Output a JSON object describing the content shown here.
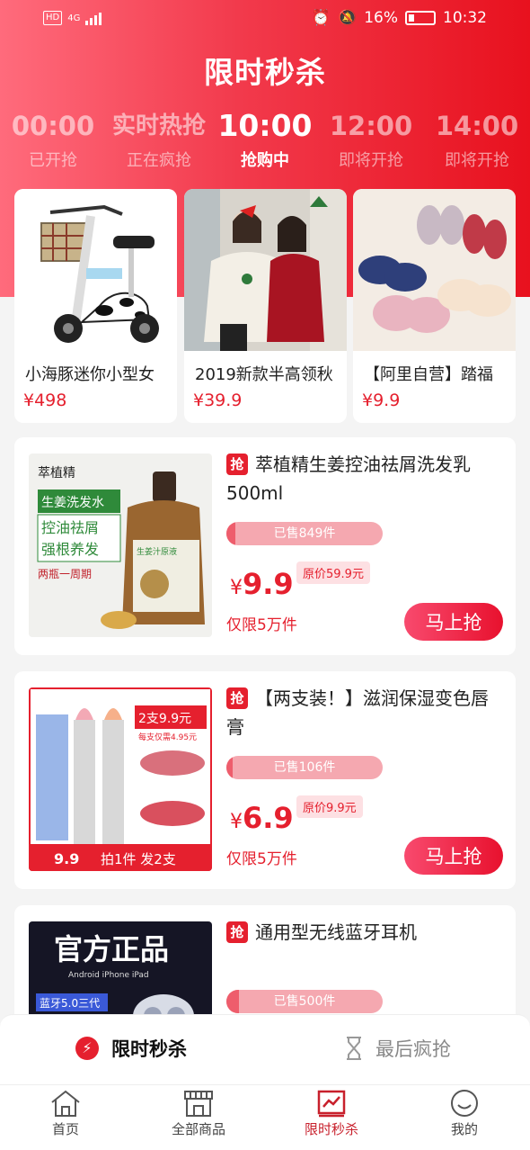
{
  "status_bar": {
    "network": "HD",
    "signal": "4G",
    "battery": "16%",
    "time": "10:32"
  },
  "header": {
    "title": "限时秒杀"
  },
  "sessions": [
    {
      "time": "00:00",
      "status": "已开抢"
    },
    {
      "time": "实时热抢",
      "status": "正在疯抢"
    },
    {
      "time": "10:00",
      "status": "抢购中"
    },
    {
      "time": "12:00",
      "status": "即将开抢"
    },
    {
      "time": "14:00",
      "status": "即将开抢"
    }
  ],
  "featured": [
    {
      "name": "小海豚迷你小型女",
      "price": "¥498"
    },
    {
      "name": "2019新款半高领秋",
      "price": "¥39.9"
    },
    {
      "name": "【阿里自营】踏福",
      "price": "¥9.9"
    }
  ],
  "items": [
    {
      "badge": "抢",
      "title": "萃植精生姜控油祛屑洗发乳500ml",
      "sold": "已售849件",
      "sold_ratio": 0.06,
      "yen": "¥",
      "price": "9.9",
      "original": "原价59.9元",
      "limit": "仅限5万件",
      "buy": "马上抢",
      "image_text": {
        "brand": "萃植精",
        "l1": "生姜洗发水",
        "l2": "控油祛屑",
        "l3": "强根养发",
        "l4": "两瓶一周期",
        "label": "生姜汁原液"
      }
    },
    {
      "badge": "抢",
      "title": "【两支装！】滋润保湿变色唇膏",
      "sold": "已售106件",
      "sold_ratio": 0.04,
      "yen": "¥",
      "price": "6.9",
      "original": "原价9.9元",
      "limit": "仅限5万件",
      "buy": "马上抢",
      "image_text": {
        "promo1": "2支9.9元",
        "promo2": "每支仅需4.95元",
        "bottom_price": "9.9",
        "bottom_text": "拍1件 发2支"
      }
    },
    {
      "badge": "抢",
      "title": "通用型无线蓝牙耳机",
      "sold": "已售500件",
      "sold_ratio": 0.08,
      "image_text": {
        "headline": "官方正品",
        "platforms": "Android  iPhone  iPad",
        "version": "蓝牙5.0三代"
      }
    }
  ],
  "sub_tabs": [
    {
      "label": "限时秒杀",
      "icon": "lightning-icon"
    },
    {
      "label": "最后疯抢",
      "icon": "hourglass-icon"
    }
  ],
  "nav": [
    {
      "label": "首页",
      "icon": "home-icon"
    },
    {
      "label": "全部商品",
      "icon": "store-icon"
    },
    {
      "label": "限时秒杀",
      "icon": "flash-sale-icon"
    },
    {
      "label": "我的",
      "icon": "profile-icon"
    }
  ],
  "colors": {
    "accent": "#e5202e",
    "hero_start": "#ff6b7c",
    "hero_end": "#e8111e"
  }
}
